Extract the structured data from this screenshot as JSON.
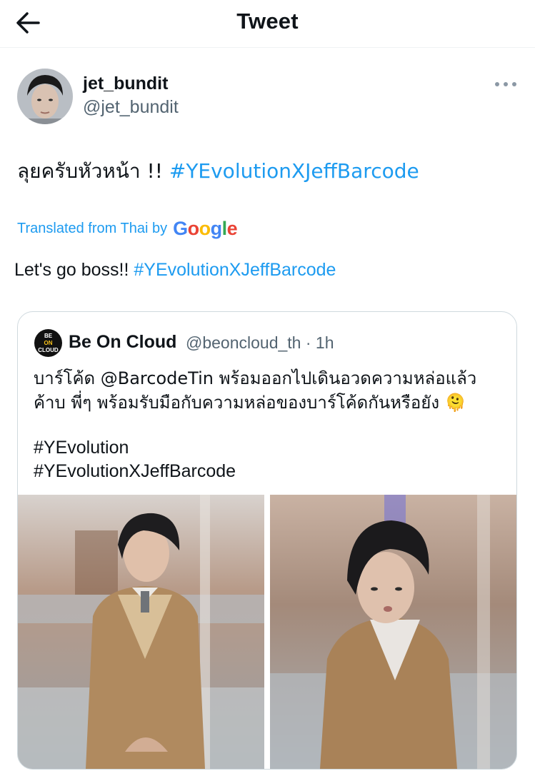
{
  "header": {
    "title": "Tweet"
  },
  "author": {
    "name": "jet_bundit",
    "handle": "@jet_bundit"
  },
  "tweet": {
    "text_th": "ลุยครับหัวหน้า !! ",
    "hashtag": "#YEvolutionXJeffBarcode",
    "translated_label": "Translated from Thai by",
    "translator": "Google",
    "text_en": "Let's go boss!! "
  },
  "quote": {
    "logo_top": "BE",
    "logo_mid": "ON",
    "logo_bottom": "CLOUD",
    "name": "Be On Cloud",
    "handle_time": "@beoncloud_th · 1h",
    "body_line1": "บาร์โค้ด @BarcodeTin พร้อมออกไปเดินอวดความหล่อแล้ว",
    "body_line2": "ค้าบ พี่ๆ พร้อมรับมือกับความหล่อของบาร์โค้ดกันหรือยัง 🫠",
    "tag1": "#YEvolution",
    "tag2": "#YEvolutionXJeffBarcode"
  },
  "icons": [
    "back-arrow-icon",
    "more-icon"
  ],
  "colors": {
    "accent": "#1d9bf0",
    "secondary_text": "#536471",
    "border": "#cfd9de"
  }
}
